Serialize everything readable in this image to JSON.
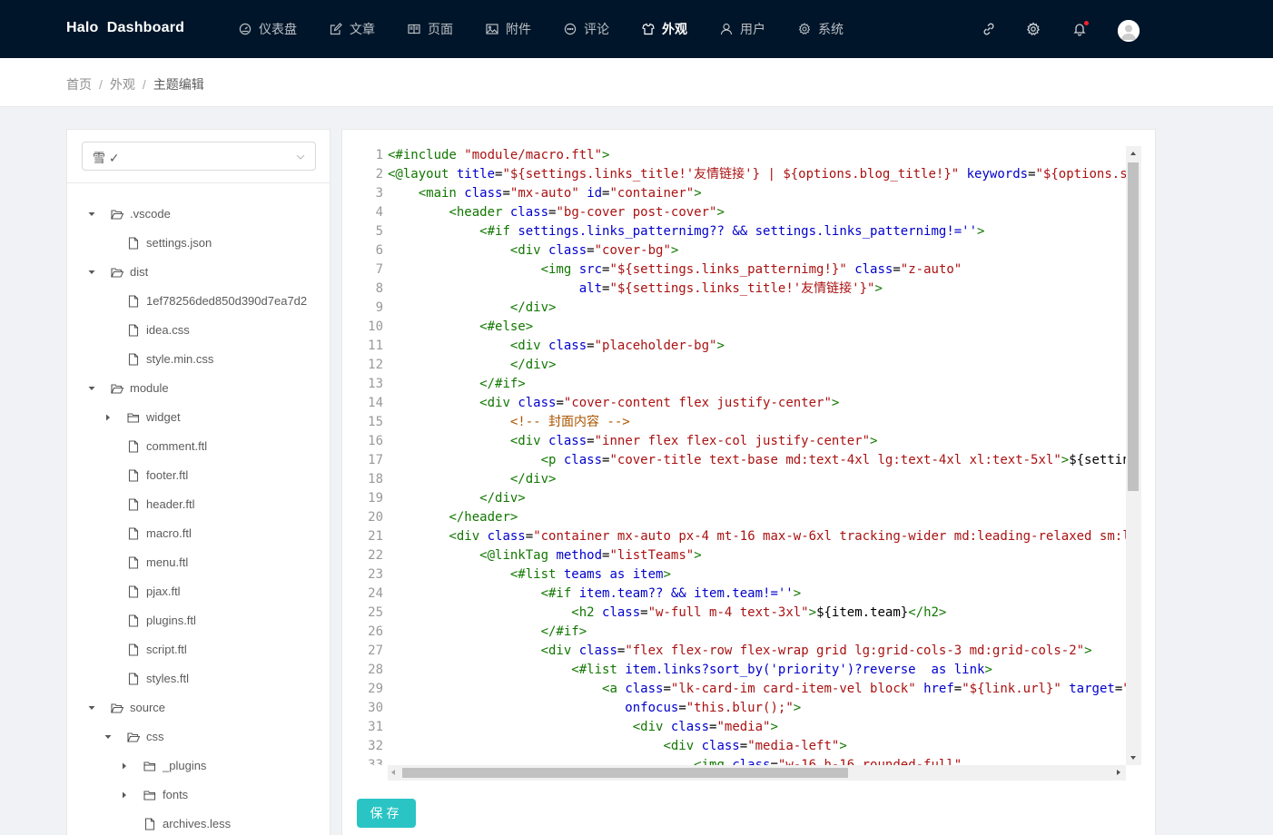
{
  "header": {
    "brand": "Halo  Dashboard",
    "nav": [
      {
        "label": "仪表盘",
        "icon": "dashboard-icon",
        "active": false
      },
      {
        "label": "文章",
        "icon": "form-icon",
        "active": false
      },
      {
        "label": "页面",
        "icon": "read-icon",
        "active": false
      },
      {
        "label": "附件",
        "icon": "picture-icon",
        "active": false
      },
      {
        "label": "评论",
        "icon": "message-icon",
        "active": false
      },
      {
        "label": "外观",
        "icon": "skin-icon",
        "active": true
      },
      {
        "label": "用户",
        "icon": "user-icon",
        "active": false
      },
      {
        "label": "系统",
        "icon": "setting-icon",
        "active": false
      }
    ],
    "tools": [
      "link-icon",
      "setting-icon",
      "bell-icon"
    ],
    "bell_has_notification": true,
    "colors": {
      "bar": "#001529",
      "badge": "#f5222d"
    }
  },
  "breadcrumb": {
    "items": [
      "首页",
      "外观",
      "主题编辑"
    ],
    "separator": "/"
  },
  "sidebar": {
    "theme_select": {
      "value": "雪 ✓"
    },
    "tree": [
      {
        "label": ".vscode",
        "type": "folder",
        "depth": 0,
        "expanded": true
      },
      {
        "label": "settings.json",
        "type": "file",
        "depth": 1
      },
      {
        "label": "dist",
        "type": "folder",
        "depth": 0,
        "expanded": true
      },
      {
        "label": "1ef78256ded850d390d7ea7d2",
        "type": "file",
        "depth": 1
      },
      {
        "label": "idea.css",
        "type": "file",
        "depth": 1
      },
      {
        "label": "style.min.css",
        "type": "file",
        "depth": 1
      },
      {
        "label": "module",
        "type": "folder",
        "depth": 0,
        "expanded": true
      },
      {
        "label": "widget",
        "type": "folder",
        "depth": 1,
        "expanded": false
      },
      {
        "label": "comment.ftl",
        "type": "file",
        "depth": 1
      },
      {
        "label": "footer.ftl",
        "type": "file",
        "depth": 1
      },
      {
        "label": "header.ftl",
        "type": "file",
        "depth": 1
      },
      {
        "label": "macro.ftl",
        "type": "file",
        "depth": 1
      },
      {
        "label": "menu.ftl",
        "type": "file",
        "depth": 1
      },
      {
        "label": "pjax.ftl",
        "type": "file",
        "depth": 1
      },
      {
        "label": "plugins.ftl",
        "type": "file",
        "depth": 1
      },
      {
        "label": "script.ftl",
        "type": "file",
        "depth": 1
      },
      {
        "label": "styles.ftl",
        "type": "file",
        "depth": 1
      },
      {
        "label": "source",
        "type": "folder",
        "depth": 0,
        "expanded": true
      },
      {
        "label": "css",
        "type": "folder",
        "depth": 1,
        "expanded": true
      },
      {
        "label": "_plugins",
        "type": "folder",
        "depth": 2,
        "expanded": false
      },
      {
        "label": "fonts",
        "type": "folder",
        "depth": 2,
        "expanded": false
      },
      {
        "label": "archives.less",
        "type": "file",
        "depth": 2
      }
    ]
  },
  "editor": {
    "lines": [
      [
        [
          "d",
          "<#include "
        ],
        [
          "s",
          "\"module/macro.ftl\""
        ],
        [
          "d",
          ">"
        ]
      ],
      [
        [
          "d",
          "<@layout "
        ],
        [
          "a",
          "title"
        ],
        [
          "t",
          "="
        ],
        [
          "s",
          "\"${settings.links_title!'友情链接'} | ${options.blog_title!}\""
        ],
        [
          "t",
          " "
        ],
        [
          "a",
          "keywords"
        ],
        [
          "t",
          "="
        ],
        [
          "s",
          "\"${options.s"
        ]
      ],
      [
        [
          "t",
          "    "
        ],
        [
          "g",
          "<main "
        ],
        [
          "a",
          "class"
        ],
        [
          "t",
          "="
        ],
        [
          "s",
          "\"mx-auto\""
        ],
        [
          "t",
          " "
        ],
        [
          "a",
          "id"
        ],
        [
          "t",
          "="
        ],
        [
          "s",
          "\"container\""
        ],
        [
          "g",
          ">"
        ]
      ],
      [
        [
          "t",
          "        "
        ],
        [
          "g",
          "<header "
        ],
        [
          "a",
          "class"
        ],
        [
          "t",
          "="
        ],
        [
          "s",
          "\"bg-cover post-cover\""
        ],
        [
          "g",
          ">"
        ]
      ],
      [
        [
          "t",
          "            "
        ],
        [
          "d",
          "<#if "
        ],
        [
          "a",
          "settings.links_patternimg?? && settings.links_patternimg!=''"
        ],
        [
          "d",
          ">"
        ]
      ],
      [
        [
          "t",
          "                "
        ],
        [
          "g",
          "<div "
        ],
        [
          "a",
          "class"
        ],
        [
          "t",
          "="
        ],
        [
          "s",
          "\"cover-bg\""
        ],
        [
          "g",
          ">"
        ]
      ],
      [
        [
          "t",
          "                    "
        ],
        [
          "g",
          "<img "
        ],
        [
          "a",
          "src"
        ],
        [
          "t",
          "="
        ],
        [
          "s",
          "\"${settings.links_patternimg!}\""
        ],
        [
          "t",
          " "
        ],
        [
          "a",
          "class"
        ],
        [
          "t",
          "="
        ],
        [
          "s",
          "\"z-auto\""
        ]
      ],
      [
        [
          "t",
          "                         "
        ],
        [
          "a",
          "alt"
        ],
        [
          "t",
          "="
        ],
        [
          "s",
          "\"${settings.links_title!'友情链接'}\""
        ],
        [
          "g",
          ">"
        ]
      ],
      [
        [
          "t",
          "                "
        ],
        [
          "g",
          "</div>"
        ]
      ],
      [
        [
          "t",
          "            "
        ],
        [
          "d",
          "<#else>"
        ]
      ],
      [
        [
          "t",
          "                "
        ],
        [
          "g",
          "<div "
        ],
        [
          "a",
          "class"
        ],
        [
          "t",
          "="
        ],
        [
          "s",
          "\"placeholder-bg\""
        ],
        [
          "g",
          ">"
        ]
      ],
      [
        [
          "t",
          "                "
        ],
        [
          "g",
          "</div>"
        ]
      ],
      [
        [
          "t",
          "            "
        ],
        [
          "d",
          "</#if>"
        ]
      ],
      [
        [
          "t",
          "            "
        ],
        [
          "g",
          "<div "
        ],
        [
          "a",
          "class"
        ],
        [
          "t",
          "="
        ],
        [
          "s",
          "\"cover-content flex justify-center\""
        ],
        [
          "g",
          ">"
        ]
      ],
      [
        [
          "t",
          "                "
        ],
        [
          "c",
          "<!-- 封面内容 -->"
        ]
      ],
      [
        [
          "t",
          "                "
        ],
        [
          "g",
          "<div "
        ],
        [
          "a",
          "class"
        ],
        [
          "t",
          "="
        ],
        [
          "s",
          "\"inner flex flex-col justify-center\""
        ],
        [
          "g",
          ">"
        ]
      ],
      [
        [
          "t",
          "                    "
        ],
        [
          "g",
          "<p "
        ],
        [
          "a",
          "class"
        ],
        [
          "t",
          "="
        ],
        [
          "s",
          "\"cover-title text-base md:text-4xl lg:text-4xl xl:text-5xl\""
        ],
        [
          "g",
          ">"
        ],
        [
          "t",
          "${settin"
        ]
      ],
      [
        [
          "t",
          "                "
        ],
        [
          "g",
          "</div>"
        ]
      ],
      [
        [
          "t",
          "            "
        ],
        [
          "g",
          "</div>"
        ]
      ],
      [
        [
          "t",
          "        "
        ],
        [
          "g",
          "</header>"
        ]
      ],
      [
        [
          "t",
          "        "
        ],
        [
          "g",
          "<div "
        ],
        [
          "a",
          "class"
        ],
        [
          "t",
          "="
        ],
        [
          "s",
          "\"container mx-auto px-4 mt-16 max-w-6xl tracking-wider md:leading-relaxed sm:l"
        ]
      ],
      [
        [
          "t",
          "            "
        ],
        [
          "d",
          "<@linkTag "
        ],
        [
          "a",
          "method"
        ],
        [
          "t",
          "="
        ],
        [
          "s",
          "\"listTeams\""
        ],
        [
          "d",
          ">"
        ]
      ],
      [
        [
          "t",
          "                "
        ],
        [
          "d",
          "<#list "
        ],
        [
          "a",
          "teams as item"
        ],
        [
          "d",
          ">"
        ]
      ],
      [
        [
          "t",
          "                    "
        ],
        [
          "d",
          "<#if "
        ],
        [
          "a",
          "item.team?? && item.team!=''"
        ],
        [
          "d",
          ">"
        ]
      ],
      [
        [
          "t",
          "                        "
        ],
        [
          "g",
          "<h2 "
        ],
        [
          "a",
          "class"
        ],
        [
          "t",
          "="
        ],
        [
          "s",
          "\"w-full m-4 text-3xl\""
        ],
        [
          "g",
          ">"
        ],
        [
          "t",
          "${item.team}"
        ],
        [
          "g",
          "</h2>"
        ]
      ],
      [
        [
          "t",
          "                    "
        ],
        [
          "d",
          "</#if>"
        ]
      ],
      [
        [
          "t",
          "                    "
        ],
        [
          "g",
          "<div "
        ],
        [
          "a",
          "class"
        ],
        [
          "t",
          "="
        ],
        [
          "s",
          "\"flex flex-row flex-wrap grid lg:grid-cols-3 md:grid-cols-2\""
        ],
        [
          "g",
          ">"
        ]
      ],
      [
        [
          "t",
          "                        "
        ],
        [
          "d",
          "<#list "
        ],
        [
          "a",
          "item.links?sort_by('priority')?reverse  as link"
        ],
        [
          "d",
          ">"
        ]
      ],
      [
        [
          "t",
          "                            "
        ],
        [
          "g",
          "<a "
        ],
        [
          "a",
          "class"
        ],
        [
          "t",
          "="
        ],
        [
          "s",
          "\"lk-card-im card-item-vel block\""
        ],
        [
          "t",
          " "
        ],
        [
          "a",
          "href"
        ],
        [
          "t",
          "="
        ],
        [
          "s",
          "\"${link.url}\""
        ],
        [
          "t",
          " "
        ],
        [
          "a",
          "target"
        ],
        [
          "t",
          "="
        ],
        [
          "s",
          "\""
        ]
      ],
      [
        [
          "t",
          "                               "
        ],
        [
          "a",
          "onfocus"
        ],
        [
          "t",
          "="
        ],
        [
          "s",
          "\"this.blur();\""
        ],
        [
          "g",
          ">"
        ]
      ],
      [
        [
          "t",
          "                                "
        ],
        [
          "g",
          "<div "
        ],
        [
          "a",
          "class"
        ],
        [
          "t",
          "="
        ],
        [
          "s",
          "\"media\""
        ],
        [
          "g",
          ">"
        ]
      ],
      [
        [
          "t",
          "                                    "
        ],
        [
          "g",
          "<div "
        ],
        [
          "a",
          "class"
        ],
        [
          "t",
          "="
        ],
        [
          "s",
          "\"media-left\""
        ],
        [
          "g",
          ">"
        ]
      ],
      [
        [
          "t",
          "                                        "
        ],
        [
          "g",
          "<img "
        ],
        [
          "a",
          "class"
        ],
        [
          "t",
          "="
        ],
        [
          "s",
          "\"w-16 h-16 rounded-full\""
        ]
      ]
    ],
    "line_start": 1
  },
  "save_button": {
    "label": "保存"
  }
}
